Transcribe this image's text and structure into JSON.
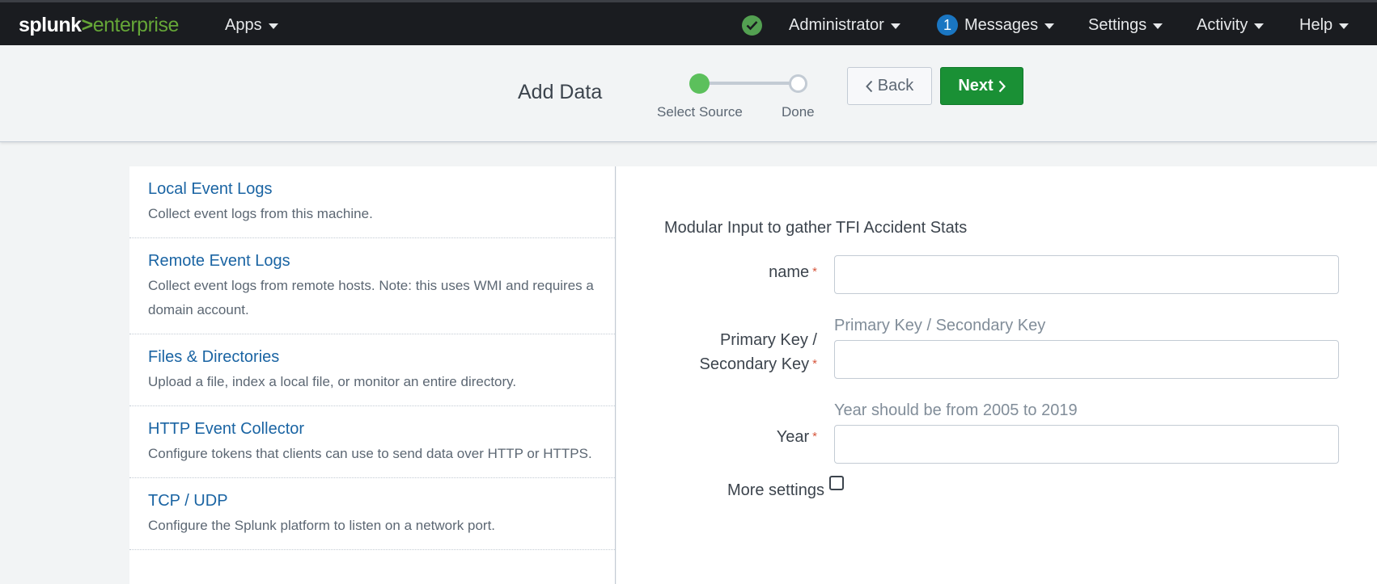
{
  "topbar": {
    "logo_brand": "splunk",
    "logo_gt": ">",
    "logo_product": "enterprise",
    "apps_label": "Apps",
    "status_icon": "check-circle-icon",
    "administrator_label": "Administrator",
    "messages_count": "1",
    "messages_label": "Messages",
    "settings_label": "Settings",
    "activity_label": "Activity",
    "help_label": "Help"
  },
  "header": {
    "title": "Add Data",
    "steps": [
      {
        "label": "Select Source",
        "state": "complete"
      },
      {
        "label": "Done",
        "state": "pending"
      }
    ],
    "back_label": "Back",
    "next_label": "Next"
  },
  "sources": [
    {
      "title": "Local Event Logs",
      "description": "Collect event logs from this machine."
    },
    {
      "title": "Remote Event Logs",
      "description": "Collect event logs from remote hosts. Note: this uses WMI and requires a domain account."
    },
    {
      "title": "Files & Directories",
      "description": "Upload a file, index a local file, or monitor an entire directory."
    },
    {
      "title": "HTTP Event Collector",
      "description": "Configure tokens that clients can use to send data over HTTP or HTTPS."
    },
    {
      "title": "TCP / UDP",
      "description": "Configure the Splunk platform to listen on a network port."
    }
  ],
  "form": {
    "title": "Modular Input to gather TFI Accident Stats",
    "fields": [
      {
        "label": "name",
        "required": "*",
        "help": "",
        "value": ""
      },
      {
        "label_line1": "Primary Key /",
        "label_line2": "Secondary Key",
        "required": "*",
        "help": "Primary Key / Secondary Key",
        "value": ""
      },
      {
        "label": "Year",
        "required": "*",
        "help": "Year should be from 2005 to 2019",
        "value": ""
      }
    ],
    "more_settings_label": "More settings",
    "more_settings_checked": false
  },
  "colors": {
    "topbar_bg": "#1a1c20",
    "brand_green": "#65a637",
    "next_button": "#1a9035",
    "link_blue": "#1a64a3",
    "required_red": "#d6563c"
  }
}
